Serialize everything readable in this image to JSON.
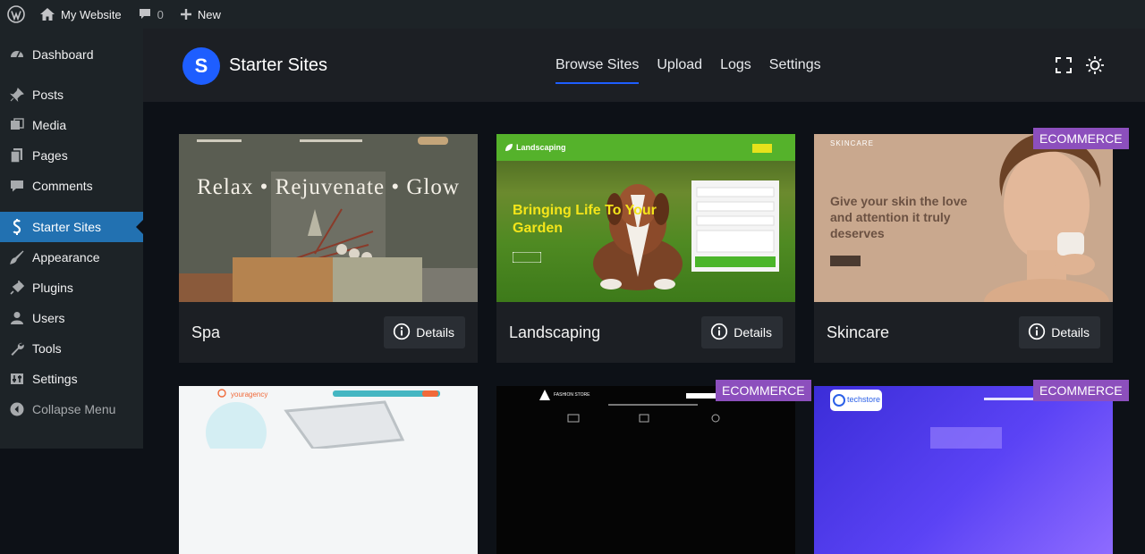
{
  "admin_bar": {
    "site_name": "My Website",
    "comments_count": "0",
    "new_label": "New"
  },
  "sidebar": {
    "items": [
      {
        "label": "Dashboard",
        "icon": "dashboard-icon"
      },
      {
        "label": "Posts",
        "icon": "pin-icon"
      },
      {
        "label": "Media",
        "icon": "media-icon"
      },
      {
        "label": "Pages",
        "icon": "pages-icon"
      },
      {
        "label": "Comments",
        "icon": "comment-icon"
      },
      {
        "label": "Starter Sites",
        "icon": "starter-sites-icon",
        "active": true
      },
      {
        "label": "Appearance",
        "icon": "brush-icon"
      },
      {
        "label": "Plugins",
        "icon": "plug-icon"
      },
      {
        "label": "Users",
        "icon": "users-icon"
      },
      {
        "label": "Tools",
        "icon": "wrench-icon"
      },
      {
        "label": "Settings",
        "icon": "settings-icon"
      }
    ],
    "collapse_label": "Collapse Menu"
  },
  "header": {
    "title": "Starter Sites",
    "logo_letter": "S",
    "tabs": [
      "Browse Sites",
      "Upload",
      "Logs",
      "Settings"
    ],
    "active_tab": "Browse Sites"
  },
  "cards": [
    {
      "title": "Spa",
      "details_label": "Details",
      "badge": ""
    },
    {
      "title": "Landscaping",
      "details_label": "Details",
      "badge": ""
    },
    {
      "title": "Skincare",
      "details_label": "Details",
      "badge": "ECOMMERCE"
    }
  ],
  "row2_badges": [
    "ECOMMERCE",
    "ECOMMERCE"
  ],
  "thumbnails": {
    "spa_heading": "Relax • Rejuvenate • Glow",
    "landscaping_logo": "Landscaping",
    "landscaping_heading": "Bringing Life To Your Garden",
    "skincare_logo": "SKINCARE",
    "skincare_heading": "Give your skin the love and attention it truly deserves",
    "agency_logo": "youragency",
    "fashion_logo": "FASHION STORE",
    "tech_logo": "techstore"
  },
  "colors": {
    "accent": "#1e5eff",
    "wp_active": "#2271b1",
    "badge": "#8c4fbd",
    "sidebar_bg": "#1d2327"
  }
}
